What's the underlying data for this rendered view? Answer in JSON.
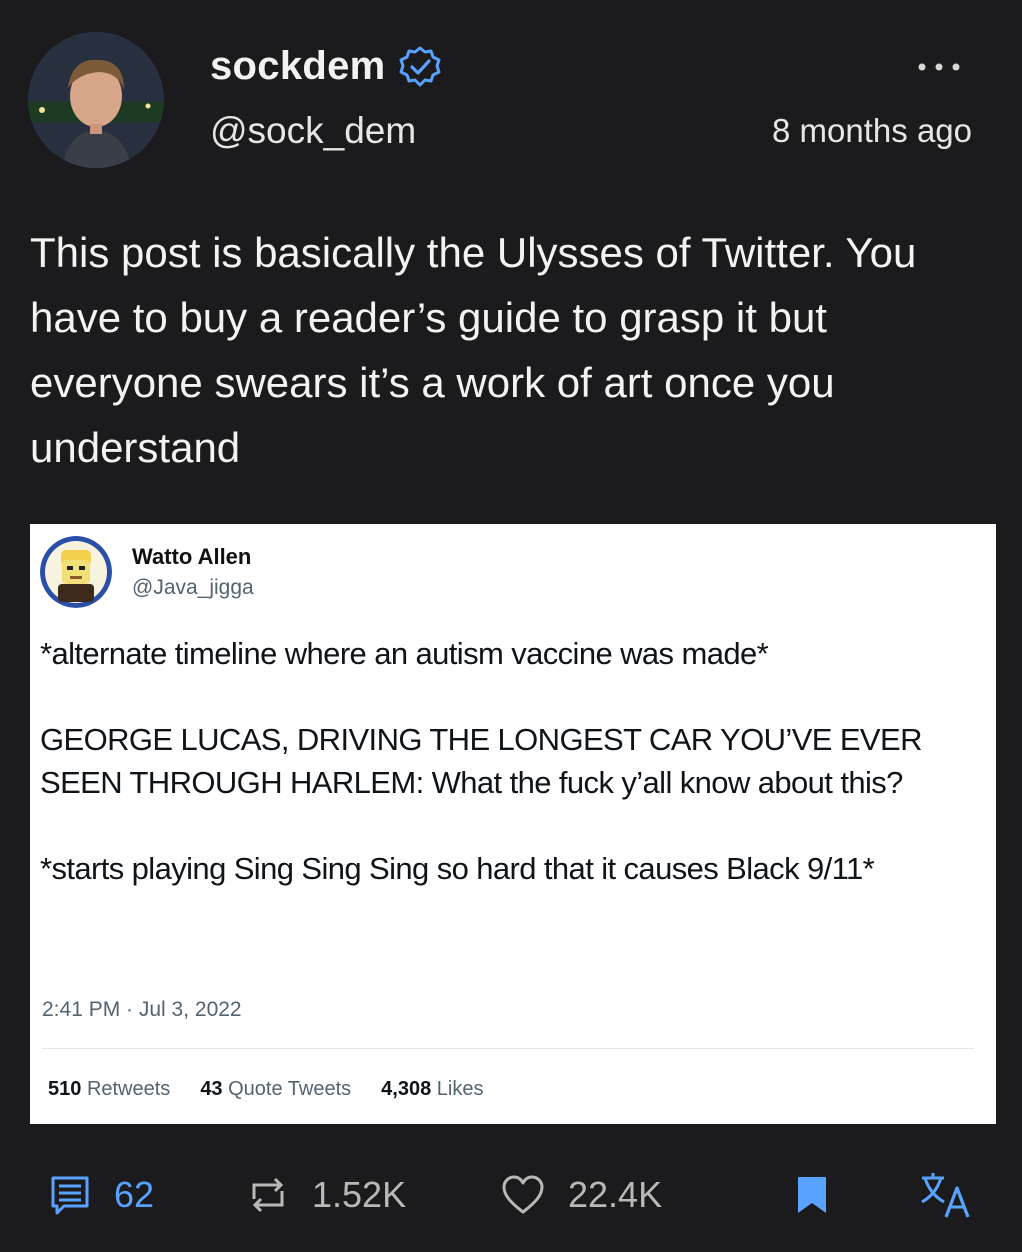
{
  "author": {
    "display_name": "sockdem",
    "handle": "@sock_dem",
    "timestamp": "8 months ago"
  },
  "post": {
    "text": "This post is basically the Ulysses of Twitter. You have to buy a reader’s guide to grasp it but everyone swears it’s a work of art once you understand"
  },
  "embedded_tweet": {
    "name": "Watto Allen",
    "handle": "@Java_jigga",
    "paragraphs": [
      "*alternate timeline where an autism vaccine was made*",
      "GEORGE LUCAS, DRIVING THE LONGEST CAR YOU’VE EVER SEEN THROUGH HARLEM: What the fuck y’all know about this?",
      "*starts playing Sing Sing Sing so hard that it causes Black 9/11*"
    ],
    "date": "2:41 PM · Jul 3, 2022",
    "stats": {
      "retweets_count": "510",
      "retweets_label": "Retweets",
      "quotes_count": "43",
      "quotes_label": "Quote Tweets",
      "likes_count": "4,308",
      "likes_label": "Likes"
    }
  },
  "actions": {
    "replies": "62",
    "reposts": "1.52K",
    "likes": "22.4K"
  },
  "colors": {
    "background": "#1b1b1d",
    "accent": "#5aa2ff",
    "muted": "#b8b8b8"
  }
}
